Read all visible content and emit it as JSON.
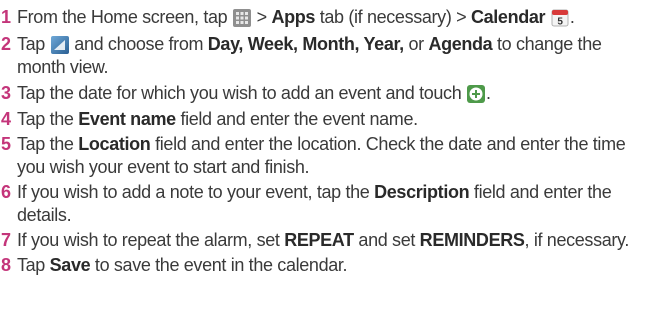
{
  "colors": {
    "step_number": "#c4357a",
    "text": "#3a3a3a"
  },
  "steps": [
    {
      "number": "1",
      "a": "From the Home screen, tap",
      "icon1": "apps-grid-icon",
      "b": " > ",
      "c": "Apps",
      "d": " tab (if necessary) > ",
      "e": "Calendar",
      "icon2": "calendar-icon",
      "icon2_text": "5",
      "f": "."
    },
    {
      "number": "2",
      "a": "Tap",
      "icon1": "view-menu-icon",
      "b": " and choose from ",
      "c": "Day, Week, Month, Year,",
      "d": " or ",
      "e": "Agenda",
      "f": " to change the",
      "line2": "month view."
    },
    {
      "number": "3",
      "a": "Tap the date for which you wish to add an event and touch",
      "icon1": "add-icon",
      "b": "."
    },
    {
      "number": "4",
      "a": "Tap the ",
      "b": "Event name",
      "c": " field and enter the event name."
    },
    {
      "number": "5",
      "a": "Tap the ",
      "b": "Location",
      "c": " field and enter the location. Check the date and enter the time",
      "line2": "you wish your event to start and finish."
    },
    {
      "number": "6",
      "a": "If you wish to add a note to your event, tap the ",
      "b": "Description",
      "c": " field and enter the",
      "line2": "details."
    },
    {
      "number": "7",
      "a": "If you wish to repeat the alarm, set ",
      "b": "REPEAT",
      "c": " and set ",
      "d": "REMINDERS",
      "e": ", if necessary."
    },
    {
      "number": "8",
      "a": "Tap ",
      "b": "Save",
      "c": " to save the event in the calendar."
    }
  ]
}
